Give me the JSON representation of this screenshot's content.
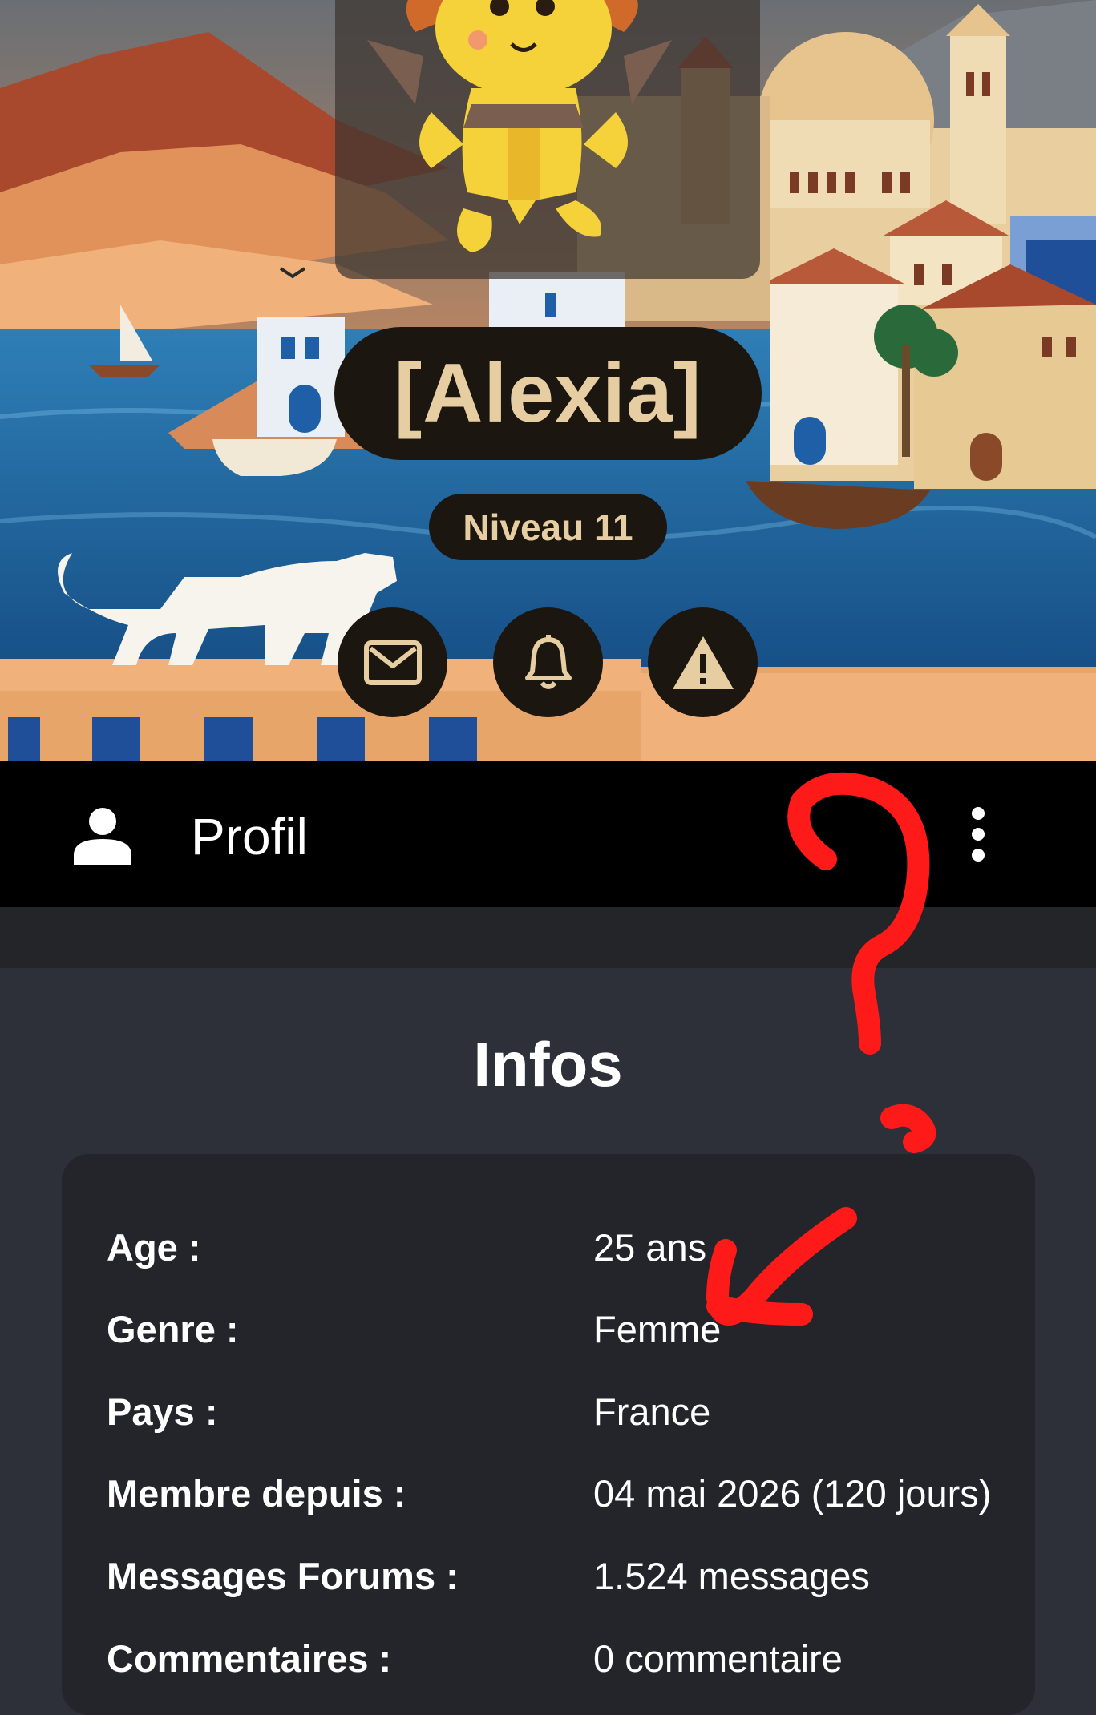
{
  "profile": {
    "name": "[Alexia]",
    "level_badge": "Niveau 11"
  },
  "actions": [
    {
      "name": "message",
      "icon": "envelope-icon"
    },
    {
      "name": "notifications",
      "icon": "bell-icon"
    },
    {
      "name": "report",
      "icon": "warning-icon"
    }
  ],
  "topbar": {
    "title": "Profil",
    "icon": "person-icon",
    "menu_icon": "more-vertical-icon"
  },
  "infos": {
    "heading": "Infos",
    "rows": [
      {
        "label": "Age :",
        "value": "25 ans"
      },
      {
        "label": "Genre :",
        "value": "Femme"
      },
      {
        "label": "Pays :",
        "value": "France"
      },
      {
        "label": "Membre depuis :",
        "value": "04 mai 2026 (120 jours)"
      },
      {
        "label": "Messages Forums :",
        "value": "1.524 messages"
      },
      {
        "label": "Commentaires :",
        "value": "0 commentaire"
      }
    ]
  },
  "colors": {
    "accent_gold": "#e7cda2",
    "pill_bg": "#1b160f",
    "topbar_bg": "#000000",
    "content_bg": "#2d3038",
    "card_bg": "#23252b",
    "annotation_red": "#ff1a1a"
  }
}
